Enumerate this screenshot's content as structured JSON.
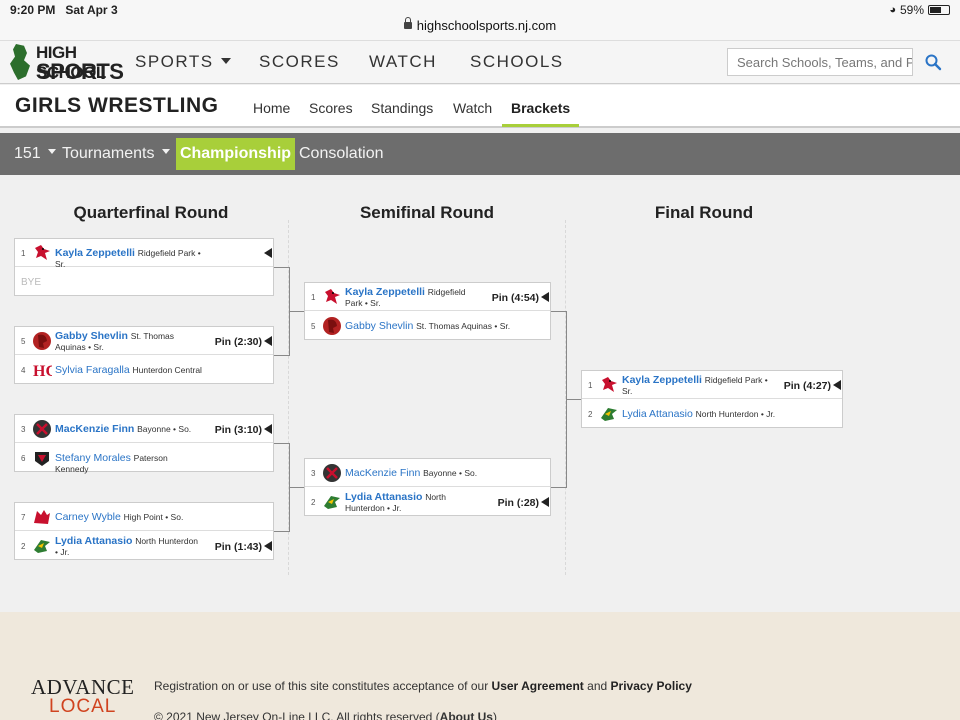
{
  "status_bar": {
    "time": "9:20 PM",
    "date": "Sat Apr 3",
    "url": "highschoolsports.nj.com",
    "battery": "59%",
    "battery_level": 0.59
  },
  "logo": {
    "line1": "HIGH SCHOOL",
    "line2": "SPORTS"
  },
  "main_nav": {
    "sports": "SPORTS",
    "scores": "SCORES",
    "watch": "WATCH",
    "schools": "SCHOOLS",
    "search_placeholder": "Search Schools, Teams, and P"
  },
  "sub_nav": {
    "title": "GIRLS WRESTLING",
    "home": "Home",
    "scores": "Scores",
    "standings": "Standings",
    "watch": "Watch",
    "brackets": "Brackets"
  },
  "filter_bar": {
    "weight": "151",
    "tournaments": "Tournaments",
    "championship": "Championship",
    "consolation": "Consolation"
  },
  "rounds": {
    "quarterfinal": "Quarterfinal Round",
    "semifinal": "Semifinal Round",
    "final": "Final Round"
  },
  "quarterfinals": [
    {
      "top": {
        "seed": "1",
        "name": "Kayla Zeppetelli",
        "detail": "Ridgefield Park • Sr.",
        "result": ""
      },
      "bottom": {
        "bye": "BYE"
      }
    },
    {
      "top": {
        "seed": "5",
        "name": "Gabby Shevlin",
        "detail": "St. Thomas Aquinas • Sr.",
        "result": "Pin (2:30)"
      },
      "bottom": {
        "seed": "4",
        "name": "Sylvia Faragalla",
        "detail": "Hunterdon Central"
      }
    },
    {
      "top": {
        "seed": "3",
        "name": "MacKenzie Finn",
        "detail": "Bayonne • So.",
        "result": "Pin (3:10)"
      },
      "bottom": {
        "seed": "6",
        "name": "Stefany Morales",
        "detail": "Paterson Kennedy"
      }
    },
    {
      "top": {
        "seed": "7",
        "name": "Carney Wyble",
        "detail": "High Point • So."
      },
      "bottom": {
        "seed": "2",
        "name": "Lydia Attanasio",
        "detail": "North Hunterdon • Jr.",
        "result": "Pin (1:43)"
      }
    }
  ],
  "semifinals": [
    {
      "top": {
        "seed": "1",
        "name": "Kayla Zeppetelli",
        "detail": "Ridgefield Park • Sr.",
        "result": "Pin (4:54)"
      },
      "bottom": {
        "seed": "5",
        "name": "Gabby Shevlin",
        "detail": "St. Thomas Aquinas • Sr."
      }
    },
    {
      "top": {
        "seed": "3",
        "name": "MacKenzie Finn",
        "detail": "Bayonne • So."
      },
      "bottom": {
        "seed": "2",
        "name": "Lydia Attanasio",
        "detail": "North Hunterdon • Jr.",
        "result": "Pin (:28)"
      }
    }
  ],
  "final": {
    "top": {
      "seed": "1",
      "name": "Kayla Zeppetelli",
      "detail": "Ridgefield Park • Sr.",
      "result": "Pin (4:27)"
    },
    "bottom": {
      "seed": "2",
      "name": "Lydia Attanasio",
      "detail": "North Hunterdon • Jr."
    }
  },
  "footer": {
    "brand_line1": "ADVANCE",
    "brand_line2": "LOCAL",
    "notice_pre": "Registration on or use of this site constitutes acceptance of our",
    "user_agreement": "User Agreement",
    "and": "and",
    "privacy_policy": "Privacy Policy",
    "copyright": "© 2021 New Jersey On-Line LLC. All rights reserved",
    "about_us": "About Us"
  },
  "colors": {
    "accent": "#a8cf3a",
    "link": "#2a74c6",
    "filter_bar": "#6d6d6d",
    "footer_bg": "#efe8dc",
    "local_red": "#d0431f"
  }
}
